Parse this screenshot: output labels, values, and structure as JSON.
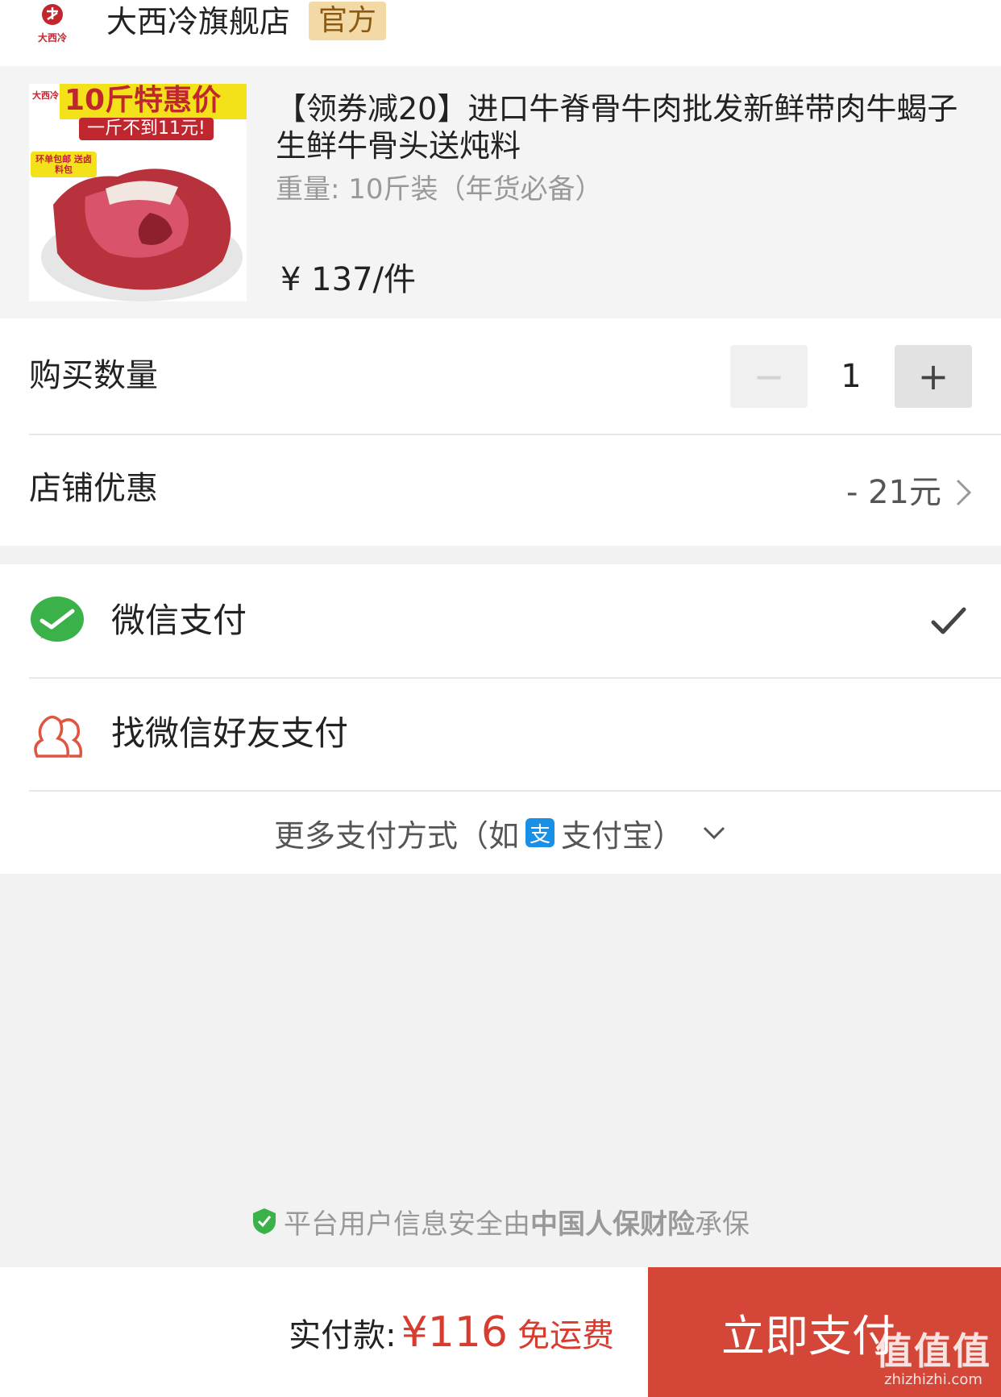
{
  "store": {
    "logo_text": "大西冷",
    "name": "大西冷旗舰店",
    "badge": "官方"
  },
  "product": {
    "image_text": {
      "promo": "10斤特惠价",
      "sub": "一斤不到11元!",
      "burst": "环单包邮 送卤料包",
      "logo": "大西冷"
    },
    "title": "【领券减20】进口牛脊骨牛肉批发新鲜带肉牛蝎子生鲜牛骨头送炖料",
    "spec": "重量: 10斤装（年货必备）",
    "price": "¥ 137/件"
  },
  "order": {
    "quantity_label": "购买数量",
    "quantity_minus": "−",
    "quantity_value": "1",
    "quantity_plus": "+",
    "discount_label": "店铺优惠",
    "discount_value": "- 21元"
  },
  "payment": {
    "wechat_label": "微信支付",
    "friend_label": "找微信好友支付",
    "more_prefix": "更多支付方式（如",
    "alipay_icon_char": "支",
    "more_suffix": "支付宝）",
    "selected": "wechat"
  },
  "security": {
    "prefix": "平台用户信息安全由",
    "insurer": "中国人保财险",
    "suffix": "承保"
  },
  "footer": {
    "total_label": "实付款:",
    "total_amount": "¥116",
    "shipping": "免运费",
    "pay_button": "立即支付"
  },
  "watermark": {
    "big": "值值值",
    "small": "zhizhizhi.com"
  },
  "colors": {
    "accent_red": "#d83c2f",
    "pay_button": "#d44637",
    "wechat_green": "#3bb14a",
    "official_badge": "#f2d9a6"
  }
}
